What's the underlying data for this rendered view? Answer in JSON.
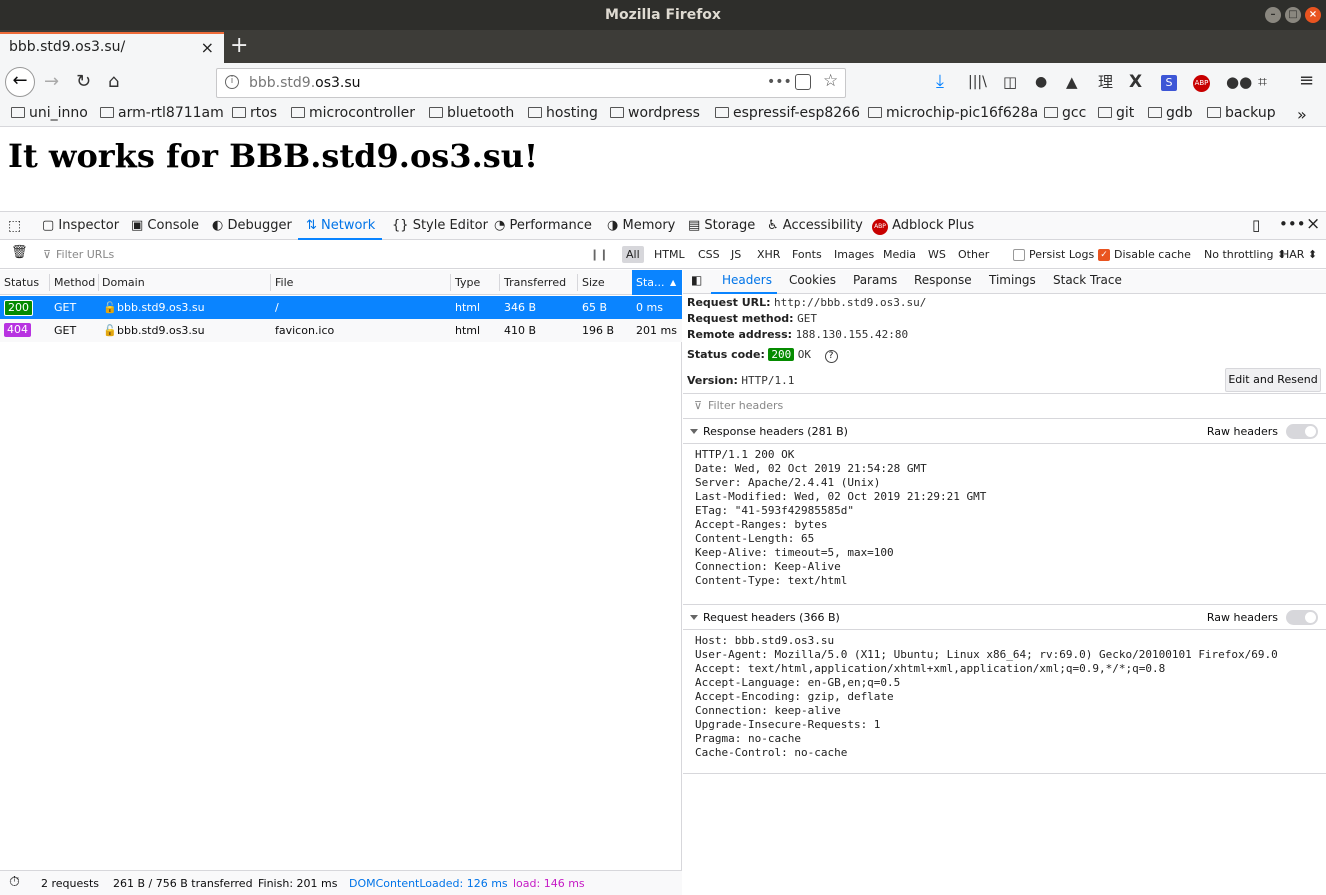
{
  "window": {
    "title": "Mozilla Firefox"
  },
  "tab": {
    "title": "bbb.std9.os3.su/"
  },
  "url": {
    "host_gray": "bbb.std9.",
    "host_dark": "os3.su",
    "page_actions": "•••"
  },
  "bookmarks": [
    "uni_inno",
    "arm-rtl8711am",
    "rtos",
    "microcontroller",
    "bluetooth",
    "hosting",
    "wordpress",
    "espressif-esp8266",
    "microchip-pic16f628a",
    "gcc",
    "git",
    "gdb",
    "backup"
  ],
  "page": {
    "heading": "It works for BBB.std9.os3.su!"
  },
  "devtools": {
    "tabs": [
      "Inspector",
      "Console",
      "Debugger",
      "Network",
      "Style Editor",
      "Performance",
      "Memory",
      "Storage",
      "Accessibility",
      "Adblock Plus"
    ],
    "selected_tab": "Network"
  },
  "filter": {
    "placeholder": "Filter URLs",
    "types": [
      "All",
      "HTML",
      "CSS",
      "JS",
      "XHR",
      "Fonts",
      "Images",
      "Media",
      "WS",
      "Other"
    ],
    "persist_logs": "Persist Logs",
    "disable_cache": "Disable cache",
    "throttling": "No throttling ⬍",
    "har": "HAR ⬍"
  },
  "table": {
    "headers": [
      "Status",
      "Method",
      "Domain",
      "File",
      "Type",
      "Transferred",
      "Size",
      "Sta..."
    ],
    "rows": [
      {
        "status": "200",
        "method": "GET",
        "domain": "bbb.std9.os3.su",
        "file": "/",
        "type": "html",
        "transferred": "346 B",
        "size": "65 B",
        "time": "0 ms",
        "badge_color": "#058b00"
      },
      {
        "status": "404",
        "method": "GET",
        "domain": "bbb.std9.os3.su",
        "file": "favicon.ico",
        "type": "html",
        "transferred": "410 B",
        "size": "196 B",
        "time": "201 ms",
        "badge_color": "#b833e1"
      }
    ]
  },
  "status_bar": {
    "requests": "2 requests",
    "transferred": "261 B / 756 B transferred",
    "finish": "Finish: 201 ms",
    "dcl": "DOMContentLoaded: 126 ms",
    "load": "load: 146 ms"
  },
  "details": {
    "tabs": [
      "Headers",
      "Cookies",
      "Params",
      "Response",
      "Timings",
      "Stack Trace"
    ],
    "request_url_label": "Request URL:",
    "request_url": "http://bbb.std9.os3.su/",
    "method_label": "Request method:",
    "method": "GET",
    "remote_label": "Remote address:",
    "remote": "188.130.155.42:80",
    "status_label": "Status code:",
    "status_code": "200",
    "status_text": "OK",
    "version_label": "Version:",
    "version": "HTTP/1.1",
    "edit_resend": "Edit and Resend",
    "filter_headers": "Filter headers",
    "response_title": "Response headers (281 B)",
    "request_title": "Request headers (366 B)",
    "raw_headers": "Raw headers",
    "response_lines": [
      "HTTP/1.1 200 OK",
      "Date: Wed, 02 Oct 2019 21:54:28 GMT",
      "Server: Apache/2.4.41 (Unix)",
      "Last-Modified: Wed, 02 Oct 2019 21:29:21 GMT",
      "ETag: \"41-593f42985585d\"",
      "Accept-Ranges: bytes",
      "Content-Length: 65",
      "Keep-Alive: timeout=5, max=100",
      "Connection: Keep-Alive",
      "Content-Type: text/html"
    ],
    "request_lines": [
      "Host: bbb.std9.os3.su",
      "User-Agent: Mozilla/5.0 (X11; Ubuntu; Linux x86_64; rv:69.0) Gecko/20100101 Firefox/69.0",
      "Accept: text/html,application/xhtml+xml,application/xml;q=0.9,*/*;q=0.8",
      "Accept-Language: en-GB,en;q=0.5",
      "Accept-Encoding: gzip, deflate",
      "Connection: keep-alive",
      "Upgrade-Insecure-Requests: 1",
      "Pragma: no-cache",
      "Cache-Control: no-cache"
    ]
  },
  "colors": {
    "accent": "#0a84ff",
    "selected_row": "#0a84ff",
    "dcl": "#0074e8",
    "load": "#c51ac5"
  }
}
